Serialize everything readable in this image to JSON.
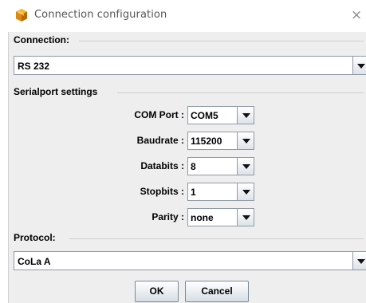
{
  "window": {
    "title": "Connection configuration",
    "icon": "cube-app-icon",
    "close_glyph": "×"
  },
  "connection": {
    "label": "Connection:",
    "value": "RS 232"
  },
  "serial": {
    "label": "Serialport settings",
    "fields": [
      {
        "label": "COM Port :",
        "value": "COM5"
      },
      {
        "label": "Baudrate :",
        "value": "115200"
      },
      {
        "label": "Databits :",
        "value": "8"
      },
      {
        "label": "Stopbits :",
        "value": "1"
      },
      {
        "label": "Parity :",
        "value": "none"
      }
    ]
  },
  "protocol": {
    "label": "Protocol:",
    "value": "CoLa A"
  },
  "buttons": {
    "ok": "OK",
    "cancel": "Cancel"
  },
  "colors": {
    "accent": "#e0a010",
    "panel_bg": "#eeeeee",
    "border": "#8e9aa5"
  }
}
